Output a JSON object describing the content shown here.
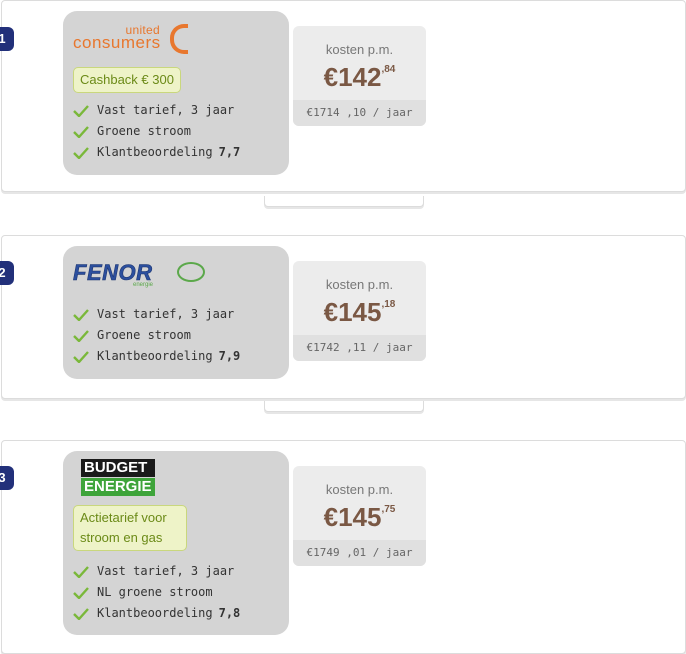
{
  "offers": [
    {
      "rank": "1",
      "logo": {
        "type": "united-consumers",
        "small": "united",
        "big": "consumers"
      },
      "badge": "Cashback € 300",
      "features": [
        {
          "text": "Vast tarief, 3 jaar",
          "bold": ""
        },
        {
          "text": "Groene stroom",
          "bold": ""
        },
        {
          "text": "Klantbeoordeling",
          "bold": "7,7"
        }
      ],
      "price": {
        "label": "kosten p.m.",
        "main": "€142",
        "cents": ",84",
        "year": "€1714 ,10 / jaar"
      }
    },
    {
      "rank": "2",
      "logo": {
        "type": "fenor",
        "text": "FENOR",
        "sub": "energie"
      },
      "badge": "",
      "features": [
        {
          "text": "Vast tarief, 3 jaar",
          "bold": ""
        },
        {
          "text": "Groene stroom",
          "bold": ""
        },
        {
          "text": "Klantbeoordeling",
          "bold": "7,9"
        }
      ],
      "price": {
        "label": "kosten p.m.",
        "main": "€145",
        "cents": ",18",
        "year": "€1742 ,11 / jaar"
      }
    },
    {
      "rank": "3",
      "logo": {
        "type": "budget-energie",
        "line1": "BUDGET",
        "line2": "ENERGIE"
      },
      "badge": "Actietarief voor stroom en gas",
      "features": [
        {
          "text": "Vast tarief, 3 jaar",
          "bold": ""
        },
        {
          "text": "NL groene stroom",
          "bold": ""
        },
        {
          "text": "Klantbeoordeling",
          "bold": "7,8"
        }
      ],
      "price": {
        "label": "kosten p.m.",
        "main": "€145",
        "cents": ",75",
        "year": "€1749 ,01 / jaar"
      }
    }
  ],
  "colors": {
    "accent_orange": "#e8772e",
    "price_brown": "#7a5844",
    "check_green": "#7ab83a",
    "rank_blue": "#22307a"
  }
}
